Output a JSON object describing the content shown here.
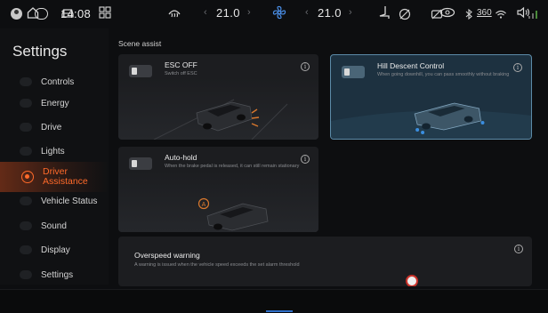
{
  "status_bar": {
    "time": "14:08",
    "icons": [
      "profile-icon",
      "message-icon",
      "seatbelt-off-icon",
      "camera-off-icon",
      "bluetooth-icon",
      "wifi-icon",
      "signal-icon"
    ]
  },
  "sidebar": {
    "title": "Settings",
    "items": [
      {
        "label": "Controls",
        "active": false
      },
      {
        "label": "Energy",
        "active": false
      },
      {
        "label": "Drive",
        "active": false
      },
      {
        "label": "Lights",
        "active": false
      },
      {
        "label": "Driver Assistance",
        "label_line1": "Driver",
        "label_line2": "Assistance",
        "active": true
      },
      {
        "label": "Vehicle Status",
        "active": false
      },
      {
        "label": "Sound",
        "active": false
      },
      {
        "label": "Display",
        "active": false
      },
      {
        "label": "Settings",
        "active": false
      }
    ]
  },
  "main": {
    "section_title": "Scene assist",
    "cards": [
      {
        "title": "ESC OFF",
        "subtitle": "Switch off ESC",
        "enabled": false,
        "selected": false
      },
      {
        "title": "Hill Descent Control",
        "subtitle": "When going downhill, you can pass smoothly without braking",
        "enabled": false,
        "selected": true
      },
      {
        "title": "Auto-hold",
        "subtitle": "When the brake pedal is released, it can still remain stationary",
        "enabled": false,
        "selected": false
      },
      {
        "title": "Overspeed warning",
        "subtitle": "A warning is issued when the vehicle speed exceeds the set alarm threshold",
        "enabled": false,
        "selected": false
      }
    ]
  },
  "bottom_bar": {
    "left_temp": "21.0",
    "right_temp": "21.0",
    "view_360_label": "360",
    "icons": [
      "home-icon",
      "car-icon",
      "apps-icon",
      "defrost-icon",
      "fan-icon",
      "seat-icon",
      "camera-icon",
      "view-360-icon",
      "volume-icon"
    ]
  },
  "colors": {
    "accent": "#ff6a2a",
    "selected_card_bg": "#1d3140",
    "selected_card_border": "#5c8ba8",
    "fan_active": "#2f6fc8"
  }
}
